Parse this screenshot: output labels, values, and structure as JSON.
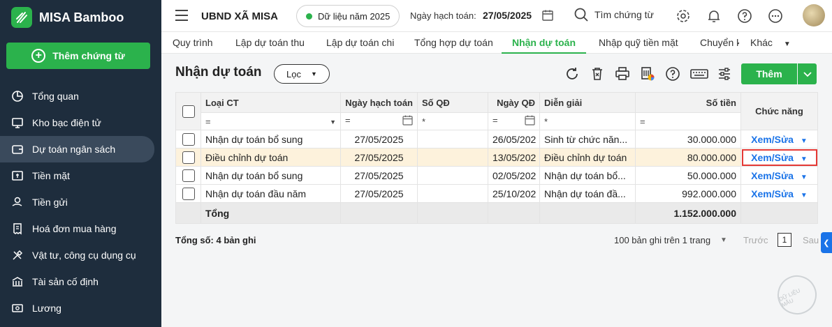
{
  "app": {
    "name": "MISA Bamboo",
    "add_voucher_label": "Thêm chứng từ"
  },
  "sidebar": {
    "items": [
      {
        "label": "Tổng quan",
        "icon": "pie-chart-icon"
      },
      {
        "label": "Kho bạc điện tử",
        "icon": "monitor-icon"
      },
      {
        "label": "Dự toán ngân sách",
        "icon": "wallet-icon",
        "active": true
      },
      {
        "label": "Tiền mặt",
        "icon": "cash-icon"
      },
      {
        "label": "Tiền gửi",
        "icon": "hand-coin-icon"
      },
      {
        "label": "Hoá đơn mua hàng",
        "icon": "invoice-icon"
      },
      {
        "label": "Vật tư, công cụ dụng cụ",
        "icon": "tools-icon"
      },
      {
        "label": "Tài sản cố định",
        "icon": "building-icon"
      },
      {
        "label": "Lương",
        "icon": "salary-icon"
      }
    ]
  },
  "topbar": {
    "org_name": "UBND XÃ MISA",
    "data_year": "Dữ liệu năm 2025",
    "posting_date_label": "Ngày hạch toán:",
    "posting_date_value": "27/05/2025",
    "search_placeholder": "Tìm chứng từ"
  },
  "tabs": [
    {
      "label": "Quy trình"
    },
    {
      "label": "Lập dự toán thu"
    },
    {
      "label": "Lập dự toán chi"
    },
    {
      "label": "Tổng hợp dự toán"
    },
    {
      "label": "Nhận dự toán",
      "active": true
    },
    {
      "label": "Nhập quỹ tiền mặt"
    },
    {
      "label": "Chuyển k"
    },
    {
      "label": "Khác"
    }
  ],
  "page": {
    "title": "Nhận dự toán",
    "filter_label": "Lọc",
    "add_label": "Thêm"
  },
  "table": {
    "headers": {
      "type": "Loại CT",
      "posting_date": "Ngày hạch toán",
      "decision_no": "Số QĐ",
      "decision_date": "Ngày QĐ",
      "description": "Diễn giải",
      "amount": "Số tiền",
      "actions": "Chức năng"
    },
    "filter_ops": {
      "eq": "=",
      "star": "*"
    },
    "rows": [
      {
        "type": "Nhận dự toán bổ sung",
        "posting_date": "27/05/2025",
        "decision_no": "",
        "decision_date": "26/05/202",
        "description": "Sinh từ chức năn...",
        "amount": "30.000.000",
        "action": "Xem/Sửa"
      },
      {
        "type": "Điều chỉnh dự toán",
        "posting_date": "27/05/2025",
        "decision_no": "",
        "decision_date": "13/05/202",
        "description": "Điều chỉnh dự toán",
        "amount": "80.000.000",
        "action": "Xem/Sửa",
        "selected": true
      },
      {
        "type": "Nhận dự toán bổ sung",
        "posting_date": "27/05/2025",
        "decision_no": "",
        "decision_date": "02/05/202",
        "description": "Nhận dự toán bổ...",
        "amount": "50.000.000",
        "action": "Xem/Sửa"
      },
      {
        "type": "Nhận dự toán đầu năm",
        "posting_date": "27/05/2025",
        "decision_no": "",
        "decision_date": "25/10/202",
        "description": "Nhận dự toán đầ...",
        "amount": "992.000.000",
        "action": "Xem/Sửa"
      }
    ],
    "total_label": "Tổng",
    "total_amount": "1.152.000.000"
  },
  "footer": {
    "record_count": "Tổng số: 4 bản ghi",
    "page_size": "100 bản ghi trên 1 trang",
    "prev": "Trước",
    "current_page": "1",
    "next": "Sau"
  },
  "watermark": "DỮ LIỆU MẪU",
  "colors": {
    "brand_green": "#2bb24c",
    "sidebar_bg": "#1e2d3d",
    "link_blue": "#1a73e8",
    "highlight_red": "#e53935",
    "selected_row": "#fdf2dc"
  }
}
